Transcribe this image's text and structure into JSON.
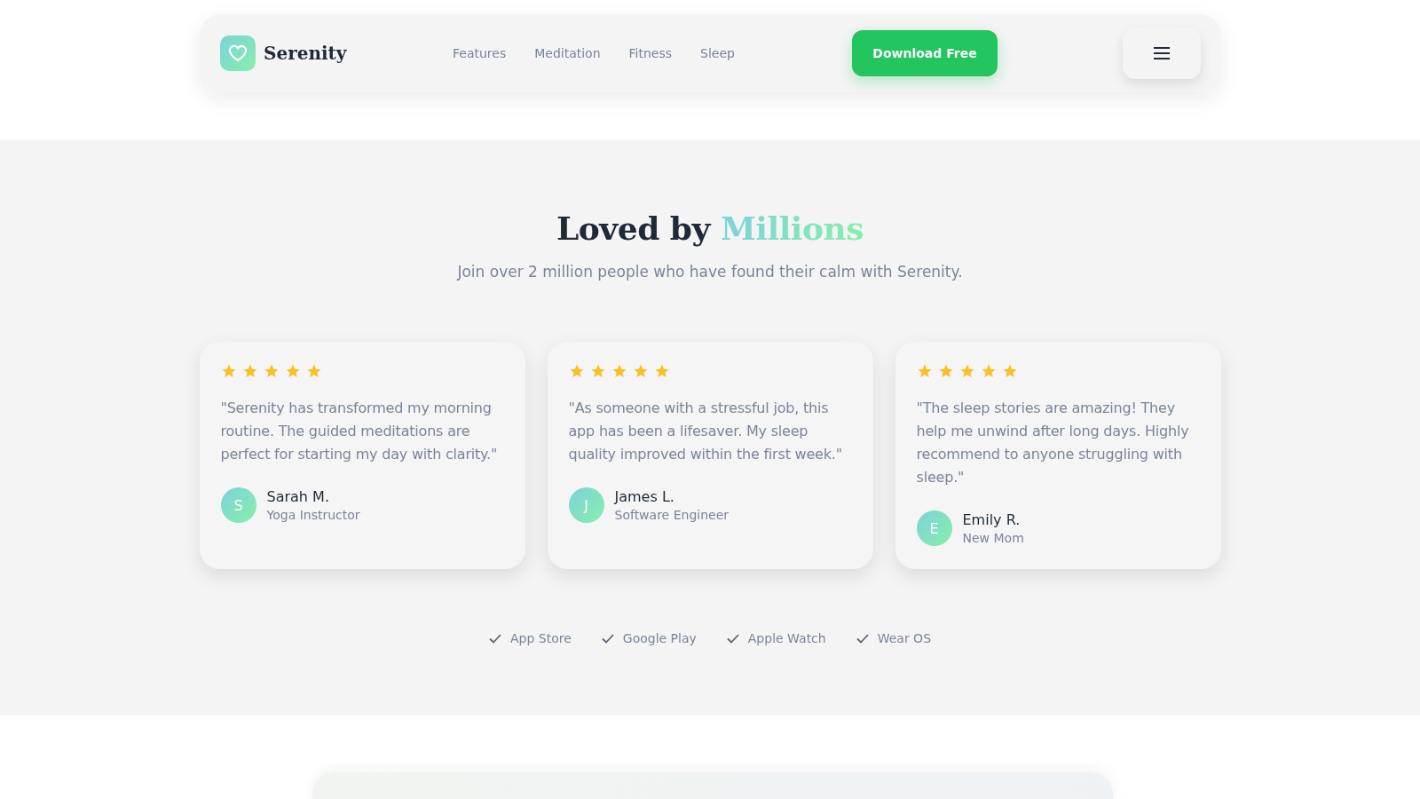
{
  "nav": {
    "brand": "Serenity",
    "links": [
      "Features",
      "Meditation",
      "Fitness",
      "Sleep"
    ],
    "cta": "Download Free"
  },
  "hero": {
    "title": "Loved by",
    "title_highlight": "Millions",
    "subtitle": "Join over 2 million people who have found their calm with Serenity."
  },
  "testimonials": [
    {
      "stars": 5,
      "quote": "\"Serenity has transformed my morning routine. The guided meditations are perfect for starting my day with clarity.\"",
      "initial": "S",
      "name": "Sarah M.",
      "role": "Yoga Instructor"
    },
    {
      "stars": 5,
      "quote": "\"As someone with a stressful job, this app has been a lifesaver. My sleep quality improved within the first week.\"",
      "initial": "J",
      "name": "James L.",
      "role": "Software Engineer"
    },
    {
      "stars": 5,
      "quote": "\"The sleep stories are amazing! They help me unwind after long days. Highly recommend to anyone struggling with sleep.\"",
      "initial": "E",
      "name": "Emily R.",
      "role": "New Mom"
    }
  ],
  "platforms": [
    "App Store",
    "Google Play",
    "Apple Watch",
    "Wear OS"
  ]
}
